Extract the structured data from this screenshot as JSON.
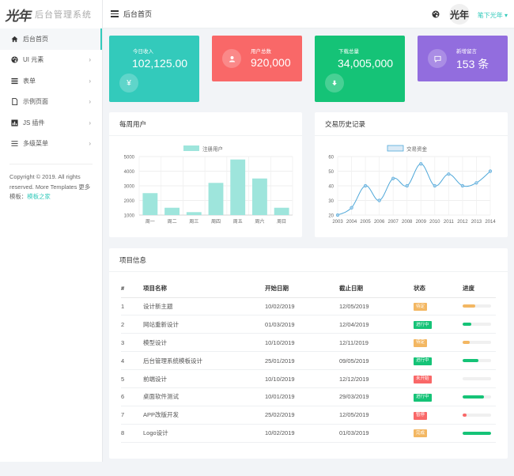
{
  "app": {
    "logo_text": "光年",
    "system_name": "后台管理系统",
    "page_title": "后台首页",
    "user_name": "笔下光年 ▾",
    "avatar_text": "光年"
  },
  "sidebar": {
    "items": [
      {
        "label": "后台首页",
        "icon": "home-icon"
      },
      {
        "label": "UI 元素",
        "icon": "palette-icon",
        "caret": "›"
      },
      {
        "label": "表单",
        "icon": "form-icon",
        "caret": "›"
      },
      {
        "label": "示例页面",
        "icon": "file-icon",
        "caret": "›"
      },
      {
        "label": "JS 插件",
        "icon": "plugin-icon",
        "caret": "›"
      },
      {
        "label": "多级菜单",
        "icon": "menu-icon",
        "caret": "›"
      }
    ],
    "copyright_text": "Copyright © 2019. All rights reserved. More Templates 更多模板：",
    "copyright_link": "模板之家"
  },
  "stats": [
    {
      "label": "今日收入",
      "value": "102,125.00",
      "icon": "yen-icon",
      "color": "#33cabb"
    },
    {
      "label": "用户总数",
      "value": "920,000",
      "icon": "user-icon",
      "color": "#f96868"
    },
    {
      "label": "下载总量",
      "value": "34,005,000",
      "icon": "download-icon",
      "color": "#15c377"
    },
    {
      "label": "新增留言",
      "value": "153 条",
      "icon": "message-icon",
      "color": "#926dde"
    }
  ],
  "weekly_panel": {
    "title": "每周用户"
  },
  "history_panel": {
    "title": "交易历史记录"
  },
  "chart_data": [
    {
      "type": "bar",
      "title": "",
      "legend": "注册用户",
      "categories": [
        "周一",
        "周二",
        "周三",
        "周四",
        "周五",
        "周六",
        "周日"
      ],
      "values": [
        2500,
        1500,
        1200,
        3200,
        4800,
        3500,
        1500
      ],
      "yticks": [
        1000,
        2000,
        3000,
        4000,
        5000
      ],
      "ylim": [
        1000,
        5000
      ],
      "color": "#9ee5dc"
    },
    {
      "type": "line",
      "title": "",
      "legend": "交易资金",
      "x": [
        "2003",
        "2004",
        "2005",
        "2006",
        "2007",
        "2008",
        "2009",
        "2010",
        "2011",
        "2012",
        "2013",
        "2014"
      ],
      "values": [
        20,
        25,
        40,
        30,
        45,
        40,
        55,
        40,
        48,
        40,
        42,
        50
      ],
      "yticks": [
        20,
        30,
        40,
        50,
        60
      ],
      "ylim": [
        20,
        60
      ],
      "color": "#4fa8d9"
    }
  ],
  "projects": {
    "title": "项目信息",
    "headers": [
      "#",
      "项目名称",
      "开始日期",
      "截止日期",
      "状态",
      "进度"
    ],
    "rows": [
      {
        "id": "1",
        "name": "设计新主题",
        "start": "10/02/2019",
        "end": "12/05/2019",
        "status": "待定",
        "status_color": "#f3b762",
        "progress": 0.45,
        "progress_color": "#f3b762"
      },
      {
        "id": "2",
        "name": "网站重新设计",
        "start": "01/03/2019",
        "end": "12/04/2019",
        "status": "进行中",
        "status_color": "#15c377",
        "progress": 0.3,
        "progress_color": "#15c377"
      },
      {
        "id": "3",
        "name": "模型设计",
        "start": "10/10/2019",
        "end": "12/11/2019",
        "status": "待定",
        "status_color": "#f3b762",
        "progress": 0.25,
        "progress_color": "#f3b762"
      },
      {
        "id": "4",
        "name": "后台管理系统模板设计",
        "start": "25/01/2019",
        "end": "09/05/2019",
        "status": "进行中",
        "status_color": "#15c377",
        "progress": 0.55,
        "progress_color": "#15c377"
      },
      {
        "id": "5",
        "name": "前端设计",
        "start": "10/10/2019",
        "end": "12/12/2019",
        "status": "未开始",
        "status_color": "#f96868",
        "progress": 0.0,
        "progress_color": "#f96868"
      },
      {
        "id": "6",
        "name": "桌面软件测试",
        "start": "10/01/2019",
        "end": "29/03/2019",
        "status": "进行中",
        "status_color": "#15c377",
        "progress": 0.75,
        "progress_color": "#15c377"
      },
      {
        "id": "7",
        "name": "APP改版开发",
        "start": "25/02/2019",
        "end": "12/05/2019",
        "status": "暂停",
        "status_color": "#f96868",
        "progress": 0.15,
        "progress_color": "#f96868"
      },
      {
        "id": "8",
        "name": "Logo设计",
        "start": "10/02/2019",
        "end": "01/03/2019",
        "status": "完成",
        "status_color": "#f3b762",
        "progress": 1.0,
        "progress_color": "#15c377"
      }
    ]
  }
}
